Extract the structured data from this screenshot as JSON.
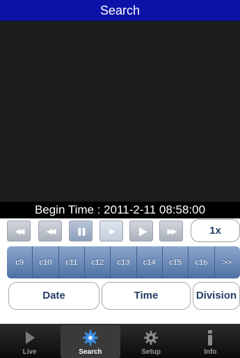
{
  "title": "Search",
  "begin_time": {
    "label": "Begin Time :",
    "value": "2011-2-11 08:58:00"
  },
  "playback": {
    "buttons": [
      {
        "name": "fast-rewind",
        "glyph": "◀◀"
      },
      {
        "name": "rewind",
        "glyph": "◀◀"
      },
      {
        "name": "pause",
        "glyph": "❚❚"
      },
      {
        "name": "play",
        "glyph": "▶"
      },
      {
        "name": "step-forward",
        "glyph": "❚▶"
      },
      {
        "name": "fast-forward",
        "glyph": "▶▶"
      }
    ],
    "speed": "1x"
  },
  "channels": [
    "c9",
    "c10",
    "c11",
    "c12",
    "c13",
    "c14",
    "c15",
    "c16",
    ">>"
  ],
  "selectors": {
    "date": "Date",
    "time": "Time",
    "division": "Division"
  },
  "tabs": [
    {
      "label": "Live",
      "icon": "play-icon",
      "active": false
    },
    {
      "label": "Search",
      "icon": "gear-icon",
      "active": true
    },
    {
      "label": "Setup",
      "icon": "gear-icon",
      "active": false
    },
    {
      "label": "Info",
      "icon": "info-icon",
      "active": false
    }
  ],
  "colors": {
    "title_bar": "#0c12a8",
    "channel_strip": "#5f7fae",
    "button_text": "#243e63"
  }
}
